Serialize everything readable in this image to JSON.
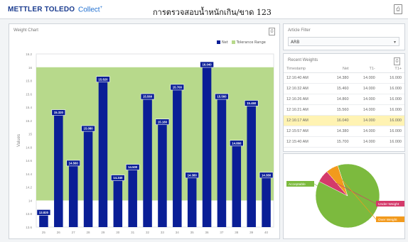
{
  "header": {
    "brand": "METTLER TOLEDO",
    "app_name": "Collect",
    "app_suffix": "+",
    "title": "การตรวจสอบน้ำหนักเกิน/ขาด 123"
  },
  "weight_chart": {
    "panel_title": "Weight Chart",
    "legend": [
      {
        "label": "Net",
        "color": "#0a1e96"
      },
      {
        "label": "Tolerance Range",
        "color": "#b7d98b"
      }
    ]
  },
  "chart_data": {
    "type": "bar",
    "categories": [
      "25",
      "26",
      "27",
      "28",
      "29",
      "30",
      "31",
      "32",
      "33",
      "34",
      "35",
      "36",
      "37",
      "38",
      "39",
      "40"
    ],
    "values": [
      13.82,
      15.32,
      14.56,
      15.08,
      15.82,
      14.34,
      14.5,
      15.56,
      15.18,
      15.7,
      14.38,
      16.04,
      15.56,
      14.86,
      15.46,
      14.38
    ],
    "value_labels": [
      "13.820",
      "15.320",
      "14.560",
      "15.080",
      "15.820",
      "14.340",
      "14.500",
      "15.560",
      "15.180",
      "15.700",
      "14.380",
      "16.040",
      "15.560",
      "14.860",
      "15.460",
      "14.380"
    ],
    "tolerance_range": [
      14.0,
      16.0
    ],
    "ylabel": "Values",
    "y_ticks": [
      "13.6",
      "13.8",
      "14",
      "14.2",
      "14.4",
      "14.6",
      "14.8",
      "15",
      "15.2",
      "15.4",
      "15.6",
      "15.8",
      "16",
      "16.2"
    ],
    "ylim": [
      13.6,
      16.2
    ],
    "grid": false
  },
  "article_filter": {
    "panel_title": "Article Filter",
    "selected": "ARB"
  },
  "recent_weights": {
    "panel_title": "Recent Weights",
    "columns": [
      "Timestamp",
      "Net",
      "T1-",
      "T1+"
    ],
    "rows": [
      {
        "time": "12:16:40 AM",
        "net": "14.380",
        "t1m": "14.000",
        "t1p": "16.000",
        "highlight": false
      },
      {
        "time": "12:16:32 AM",
        "net": "15.460",
        "t1m": "14.000",
        "t1p": "16.000",
        "highlight": false
      },
      {
        "time": "12:16:26 AM",
        "net": "14.860",
        "t1m": "14.000",
        "t1p": "16.000",
        "highlight": false
      },
      {
        "time": "12:16:21 AM",
        "net": "15.560",
        "t1m": "14.000",
        "t1p": "16.000",
        "highlight": false
      },
      {
        "time": "12:16:17 AM",
        "net": "16.040",
        "t1m": "14.000",
        "t1p": "16.000",
        "highlight": true
      },
      {
        "time": "12:15:57 AM",
        "net": "14.380",
        "t1m": "14.000",
        "t1p": "16.000",
        "highlight": false
      },
      {
        "time": "12:15:40 AM",
        "net": "15.700",
        "t1m": "14.000",
        "t1p": "16.000",
        "highlight": false
      }
    ]
  },
  "pie": {
    "slices": [
      {
        "label": "Acceptable",
        "value": 0.875,
        "color": "#7cba3e"
      },
      {
        "label": "Under Weight",
        "value": 0.0625,
        "color": "#d43a6a"
      },
      {
        "label": "Over Weight",
        "value": 0.0625,
        "color": "#f29a1d"
      }
    ]
  }
}
